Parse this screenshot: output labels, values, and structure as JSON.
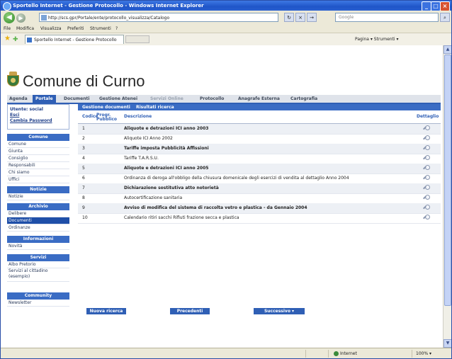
{
  "window": {
    "title": "Sportello Internet - Gestione Protocollo - Windows Internet Explorer",
    "minimize": "_",
    "maximize": "□",
    "close": "×"
  },
  "address": {
    "url": "http://scs.gpr/Portale/ente/protocollo_visualizza/Catalogo",
    "go": "→",
    "refresh": "↻",
    "stop": "×",
    "search_placeholder": "Google"
  },
  "menu": [
    "File",
    "Modifica",
    "Visualizza",
    "Preferiti",
    "Strumenti",
    "?"
  ],
  "favorites": {
    "tab_label": "Sportello Internet - Gestione Protocollo",
    "tools": "Pagina ▾   Strumenti ▾"
  },
  "site": {
    "title": "Comune di Curno"
  },
  "topnav": [
    {
      "label": "Agenda",
      "state": "normal"
    },
    {
      "label": "Portale",
      "state": "active"
    },
    {
      "label": "Documenti",
      "state": "normal"
    },
    {
      "label": "Gestione Atenei",
      "state": "normal"
    },
    {
      "label": "Servizi Online",
      "state": "dim"
    },
    {
      "label": "Protocollo",
      "state": "normal"
    },
    {
      "label": "Anagrafe Esterna",
      "state": "normal"
    },
    {
      "label": "Cartografia",
      "state": "normal"
    }
  ],
  "subnav": [
    "Gestione documenti",
    "Risultati ricerca"
  ],
  "login": {
    "line1": "Utente: social",
    "line2": "Esci",
    "line3": "Cambia Password"
  },
  "sidebar": [
    {
      "title": "Comune",
      "items": [
        "Comune",
        "Giunta",
        "Consiglio",
        "Responsabili",
        "Chi siamo",
        "Uffici"
      ]
    },
    {
      "title": "Notizie",
      "items": [
        "Notizie"
      ]
    },
    {
      "title": "Archivio",
      "items": [
        "Delibere",
        "Documenti",
        "Ordinanze"
      ],
      "selected": 1
    },
    {
      "title": "Informazioni",
      "items": [
        "Novità"
      ]
    },
    {
      "title": "Servizi",
      "items": [
        "Albo Pretorio",
        "Servizi al cittadino (esempio)"
      ]
    },
    {
      "title": "Community",
      "items": [
        "Newsletter"
      ]
    }
  ],
  "table": {
    "headers": {
      "code": "Codice",
      "prog": "Progr. Pubblico",
      "desc": "Descrizione",
      "detail": "Dettaglio"
    },
    "rows": [
      {
        "code": "1",
        "desc": "Aliquote e detrazioni ICI anno 2003",
        "bold": true
      },
      {
        "code": "2",
        "desc": "Aliquote ICI Anno 2002",
        "bold": false
      },
      {
        "code": "3",
        "desc": "Tariffe imposta Pubblicità Affissioni",
        "bold": true
      },
      {
        "code": "4",
        "desc": "Tariffe T.A.R.S.U.",
        "bold": false
      },
      {
        "code": "5",
        "desc": "Aliquote e detrazioni ICI anno 2005",
        "bold": true
      },
      {
        "code": "6",
        "desc": "Ordinanza di deroga all'obbligo della chiusura domenicale degli esercizi di vendita al dettaglio Anno 2004",
        "bold": false
      },
      {
        "code": "7",
        "desc": "Dichiarazione sostitutiva atto notorietà",
        "bold": true
      },
      {
        "code": "8",
        "desc": "Autocertificazione sanitaria",
        "bold": false
      },
      {
        "code": "9",
        "desc": "Avviso di modifica del sistema di raccolta vetro e plastica - da Gennaio 2004",
        "bold": true
      },
      {
        "code": "10",
        "desc": "Calendario ritiri sacchi Rifiuti frazione secca e plastica",
        "bold": false
      }
    ]
  },
  "buttons": {
    "new_search": "Nuova ricerca",
    "previous": "Precedenti",
    "next": "Successivo ▾"
  },
  "status": {
    "zone": "Internet",
    "zoom": "100% ▾"
  }
}
